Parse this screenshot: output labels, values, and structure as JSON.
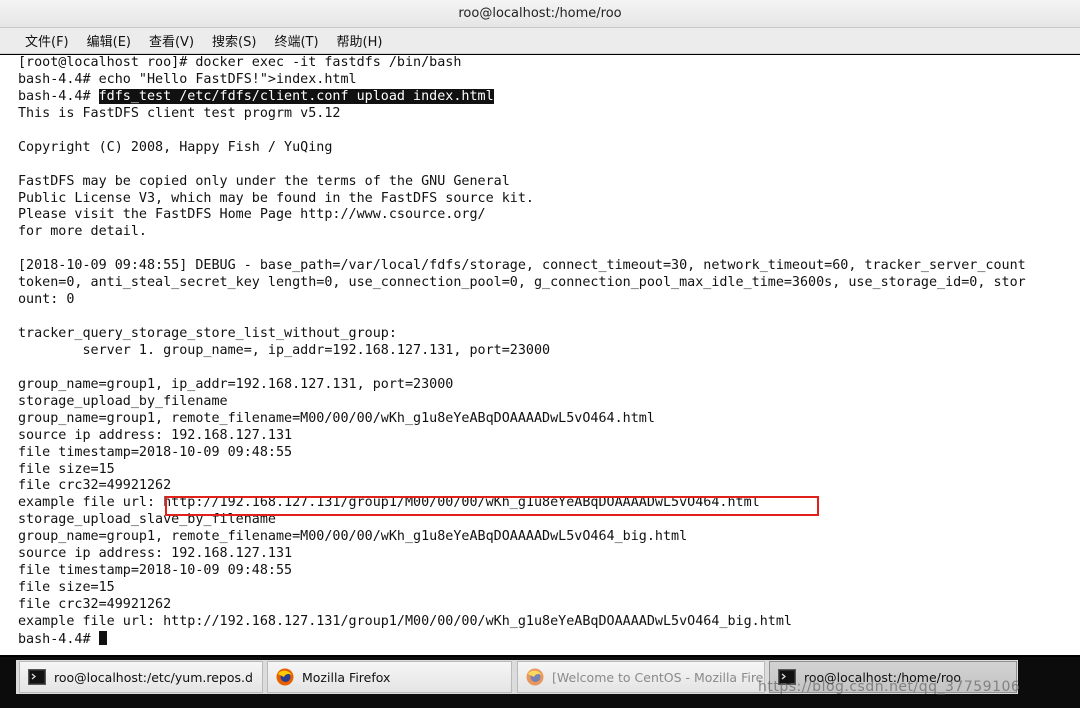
{
  "window": {
    "title": "roo@localhost:/home/roo"
  },
  "menu": [
    "文件(F)",
    "编辑(E)",
    "查看(V)",
    "搜索(S)",
    "终端(T)",
    "帮助(H)"
  ],
  "terminal": {
    "lines": [
      "[root@localhost roo]# docker exec -it fastdfs /bin/bash",
      "bash-4.4# echo \"Hello FastDFS!\">index.html",
      {
        "prefix": "bash-4.4# ",
        "highlight": "fdfs_test /etc/fdfs/client.conf upload index.html"
      },
      "This is FastDFS client test progrm v5.12",
      "",
      "Copyright (C) 2008, Happy Fish / YuQing",
      "",
      "FastDFS may be copied only under the terms of the GNU General",
      "Public License V3, which may be found in the FastDFS source kit.",
      "Please visit the FastDFS Home Page http://www.csource.org/",
      "for more detail.",
      "",
      "[2018-10-09 09:48:55] DEBUG - base_path=/var/local/fdfs/storage, connect_timeout=30, network_timeout=60, tracker_server_count",
      "token=0, anti_steal_secret_key length=0, use_connection_pool=0, g_connection_pool_max_idle_time=3600s, use_storage_id=0, stor",
      "ount: 0",
      "",
      "tracker_query_storage_store_list_without_group:",
      "        server 1. group_name=, ip_addr=192.168.127.131, port=23000",
      "",
      "group_name=group1, ip_addr=192.168.127.131, port=23000",
      "storage_upload_by_filename",
      "group_name=group1, remote_filename=M00/00/00/wKh_g1u8eYeABqDOAAAADwL5vO464.html",
      "source ip address: 192.168.127.131",
      "file timestamp=2018-10-09 09:48:55",
      "file size=15",
      "file crc32=49921262",
      "example file url: http://192.168.127.131/group1/M00/00/00/wKh_g1u8eYeABqDOAAAADwL5vO464.html",
      "storage_upload_slave_by_filename",
      "group_name=group1, remote_filename=M00/00/00/wKh_g1u8eYeABqDOAAAADwL5vO464_big.html",
      "source ip address: 192.168.127.131",
      "file timestamp=2018-10-09 09:48:55",
      "file size=15",
      "file crc32=49921262",
      "example file url: http://192.168.127.131/group1/M00/00/00/wKh_g1u8eYeABqDOAAAADwL5vO464_big.html",
      {
        "prompt": "bash-4.4# "
      }
    ]
  },
  "taskbar": {
    "items": [
      {
        "label": "roo@localhost:/etc/yum.repos.d",
        "icon": "terminal-icon"
      },
      {
        "label": "Mozilla Firefox",
        "icon": "firefox-icon"
      },
      {
        "label": "[Welcome to CentOS - Mozilla Fire···",
        "icon": "firefox-icon"
      },
      {
        "label": "roo@localhost:/home/roo",
        "icon": "terminal-icon"
      }
    ],
    "watermark": "https://blog.csdn.net/qq_37759106"
  },
  "colors": {
    "highlight_box": "#e0211c",
    "terminal_bg": "#ffffff",
    "terminal_fg": "#111111"
  }
}
